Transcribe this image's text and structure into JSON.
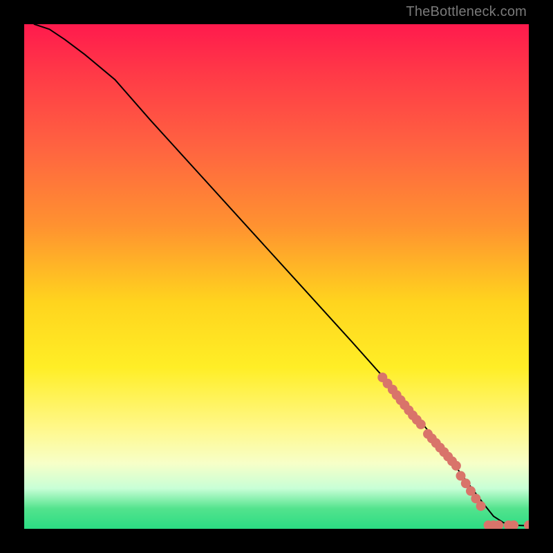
{
  "attribution": "TheBottleneck.com",
  "chart_data": {
    "type": "line",
    "title": "",
    "xlabel": "",
    "ylabel": "",
    "xlim": [
      0,
      100
    ],
    "ylim": [
      0,
      100
    ],
    "grid": false,
    "legend": false,
    "series": [
      {
        "name": "curve",
        "stroke": "#000000",
        "x": [
          2,
          5,
          8,
          12,
          18,
          25,
          35,
          45,
          55,
          65,
          73,
          78,
          82,
          85,
          88,
          91,
          93,
          95,
          97,
          100
        ],
        "y": [
          100,
          99,
          97,
          94,
          89,
          81,
          70,
          59,
          48,
          37,
          28,
          22,
          17,
          13,
          9,
          5,
          2.5,
          1.2,
          0.7,
          0.6
        ]
      },
      {
        "name": "points-upper-cluster",
        "marker": "circle",
        "color": "#d9746a",
        "x": [
          71,
          72,
          73,
          73.8,
          74.6,
          75.4,
          76.2,
          77,
          77.8,
          78.6
        ],
        "y": [
          30,
          28.8,
          27.6,
          26.5,
          25.5,
          24.5,
          23.5,
          22.5,
          21.6,
          20.7
        ]
      },
      {
        "name": "points-mid-cluster",
        "marker": "circle",
        "color": "#d9746a",
        "x": [
          80,
          80.8,
          81.6,
          82.4,
          83.2,
          84,
          84.8,
          85.6
        ],
        "y": [
          18.8,
          17.9,
          17,
          16.1,
          15.2,
          14.3,
          13.4,
          12.5
        ]
      },
      {
        "name": "points-lower-diag",
        "marker": "circle",
        "color": "#d9746a",
        "x": [
          86.5,
          87.5,
          88.5,
          89.5,
          90.5
        ],
        "y": [
          10.5,
          9,
          7.5,
          6,
          4.5
        ]
      },
      {
        "name": "points-tail-flat",
        "marker": "circle",
        "color": "#d9746a",
        "x": [
          92,
          93,
          94,
          96,
          97,
          100
        ],
        "y": [
          0.7,
          0.7,
          0.7,
          0.7,
          0.7,
          0.7
        ]
      }
    ],
    "background_gradient": {
      "direction": "vertical",
      "stops": [
        {
          "pos": 0.0,
          "color": "#ff1a4d"
        },
        {
          "pos": 0.55,
          "color": "#ffd41e"
        },
        {
          "pos": 0.8,
          "color": "#fff88a"
        },
        {
          "pos": 0.92,
          "color": "#c8ffd6"
        },
        {
          "pos": 1.0,
          "color": "#2bdc83"
        }
      ]
    }
  }
}
